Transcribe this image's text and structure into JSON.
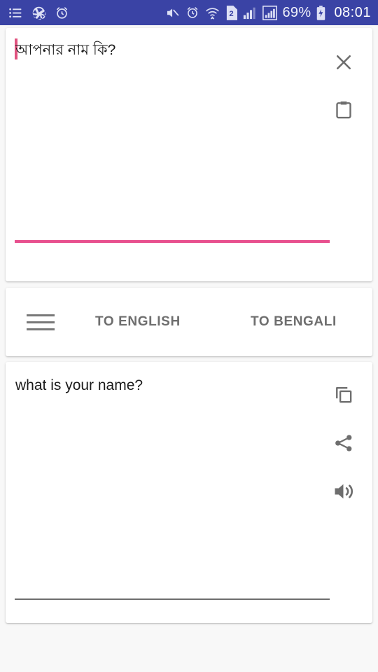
{
  "status_bar": {
    "background_color": "#3A43A5",
    "left_icons": [
      "list-icon",
      "camera-aperture-icon",
      "alarm-clock-icon"
    ],
    "right_icons": [
      "mute-icon",
      "alarm-clock-icon",
      "wifi-icon",
      "sim-2-icon",
      "signal-bars-icon",
      "signal-bars-boxed-icon"
    ],
    "sim_label": "2",
    "battery_percent": "69%",
    "battery_state": "charging",
    "time": "08:01"
  },
  "input_card": {
    "source_text": "আপনার নাম কি?",
    "caret_color": "#E0527F",
    "underline_color": "#E8508E",
    "actions": [
      {
        "name": "close-icon",
        "label": "Clear"
      },
      {
        "name": "clipboard-paste-icon",
        "label": "Paste"
      }
    ]
  },
  "toolbar": {
    "menu_label": "Menu",
    "to_english_label": "TO ENGLISH",
    "to_bengali_label": "TO BENGALI",
    "text_color": "#6E6E6E"
  },
  "output_card": {
    "translated_text": "what is your name?",
    "underline_color": "#6E6E6E",
    "actions": [
      {
        "name": "copy-icon",
        "label": "Copy"
      },
      {
        "name": "share-icon",
        "label": "Share"
      },
      {
        "name": "speaker-icon",
        "label": "Listen"
      }
    ]
  },
  "page": {
    "background_color": "#F8F8F8",
    "card_color": "#FFFFFF"
  }
}
